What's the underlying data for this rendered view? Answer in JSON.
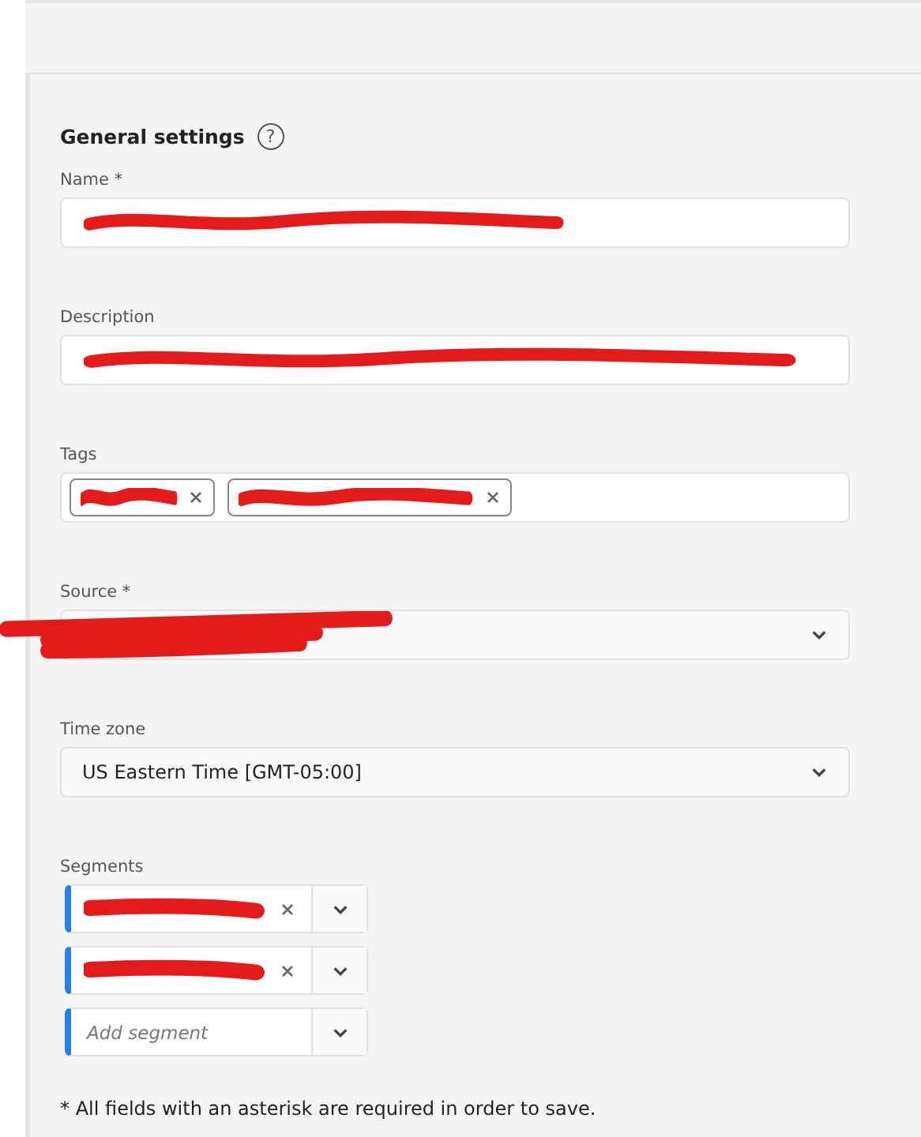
{
  "section": {
    "title": "General settings",
    "help_icon": "?"
  },
  "fields": [
    {
      "kind": "text",
      "label": "Name *",
      "redacted": true
    },
    {
      "kind": "text",
      "label": "Description",
      "redacted": true
    },
    {
      "kind": "tags",
      "label": "Tags",
      "tags": [
        {
          "redacted": true
        },
        {
          "redacted": true
        }
      ]
    },
    {
      "kind": "select",
      "label": "Source *",
      "redacted": true
    },
    {
      "kind": "select",
      "label": "Time zone",
      "value": "US Eastern Time [GMT-05:00]"
    },
    {
      "kind": "segments",
      "label": "Segments",
      "segments": [
        {
          "redacted": true
        },
        {
          "redacted": true
        }
      ],
      "placeholder": "Add segment"
    }
  ],
  "footer": "* All fields with an asterisk are required in order to save."
}
